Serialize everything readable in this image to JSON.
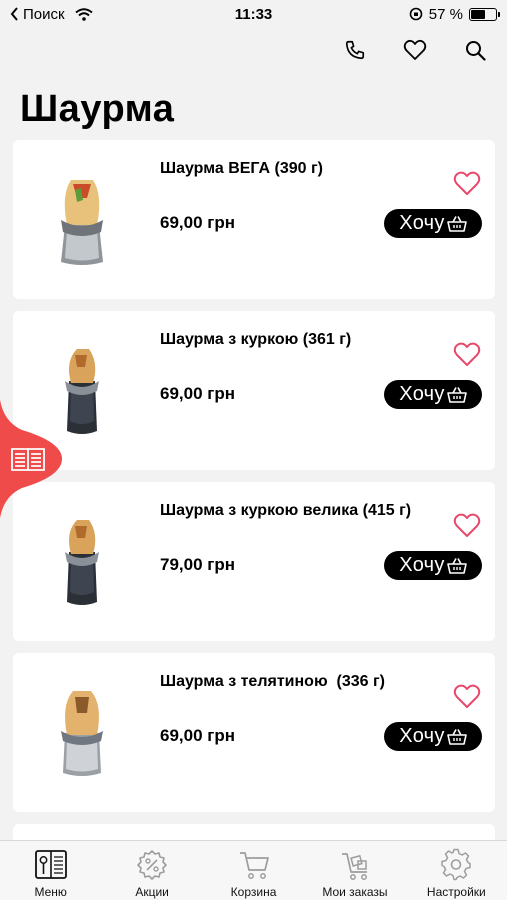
{
  "status": {
    "back_label": "Поиск",
    "time": "11:33",
    "battery": "57 %",
    "battery_level": 0.57
  },
  "header": {
    "title": "Шаурма",
    "actions": [
      {
        "name": "phone-icon"
      },
      {
        "name": "heart-icon"
      },
      {
        "name": "search-icon"
      }
    ]
  },
  "products": [
    {
      "name": "Шаурма ВЕГА (390 г)",
      "price": "69,00 грн",
      "button": "Хочу",
      "image": "shawarma-vega-image"
    },
    {
      "name": "Шаурма з куркою (361 г)",
      "price": "69,00 грн",
      "button": "Хочу",
      "image": "shawarma-chicken-image"
    },
    {
      "name": "Шаурма з куркою велика (415 г)",
      "price": "79,00 грн",
      "button": "Хочу",
      "image": "shawarma-chicken-large-image"
    },
    {
      "name": "Шаурма з телятиною  (336 г)",
      "price": "69,00 грн",
      "button": "Хочу",
      "image": "shawarma-veal-image"
    }
  ],
  "side_tab": {
    "icon": "book-icon",
    "color": "#ef4b4b"
  },
  "tabs": [
    {
      "label": "Меню",
      "icon": "menu-icon",
      "active": true
    },
    {
      "label": "Акции",
      "icon": "percent-gear-icon",
      "active": false
    },
    {
      "label": "Корзина",
      "icon": "cart-icon",
      "active": false
    },
    {
      "label": "Мои заказы",
      "icon": "orders-cart-icon",
      "active": false
    },
    {
      "label": "Настройки",
      "icon": "settings-icon",
      "active": false
    }
  ],
  "colors": {
    "accent": "#ef4b4b",
    "heart": "#e8486a",
    "button_bg": "#000000",
    "background": "#f2f2f2"
  }
}
